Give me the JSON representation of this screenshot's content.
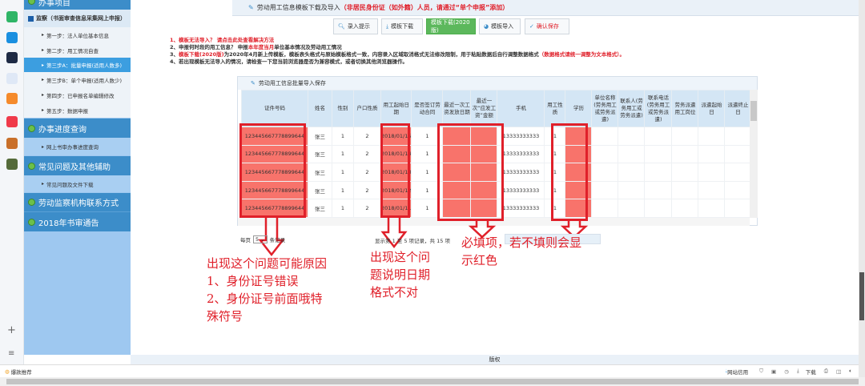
{
  "sidebar": {
    "top_label": "办事项目",
    "section_title": "监察（书面审查信息采集网上申报）",
    "steps": [
      "第一步：法人单位基本信息",
      "第二步：用工情况自查",
      "第三步A：批量申报(适用人数多)",
      "第三步B：单个申报(适用人数少)",
      "第四步：已申报名单编辑修改",
      "第五步：数据申报"
    ],
    "active_step": 2,
    "groups": [
      {
        "label": "办事进度查询",
        "sub": "网上书审办事进度查询"
      },
      {
        "label": "常见问题及其他辅助",
        "sub": "常见问题及文件下载"
      },
      {
        "label": "劳动监察机构联系方式"
      },
      {
        "label": "2018年书审通告"
      }
    ]
  },
  "header": {
    "title": "劳动用工信息模板下载及导入",
    "warning": "（非居民身份证（如外籍）人员，请通过“单个申报”添加）"
  },
  "buttons": {
    "hint": "录入提示",
    "template_download": "模板下载",
    "template_download_2020": "模板下载(2020版)",
    "template_import": "模板导入",
    "confirm_save": "确认保存"
  },
  "notes": [
    {
      "a": "1、模板无法导入？ 请点击此处查看解决方法",
      "b": "",
      "c": "",
      "d": ""
    },
    {
      "a": "2、申报何时段的用工信息？ 申报",
      "b": "本年度当月",
      "c": "单位基本情况及劳动用工情况",
      "d": ""
    },
    {
      "a": "3、",
      "b": "模板下载(2020版)",
      "c": "为2020年4月新上传模板，模板表头格式与原始模板格式一致，内容录入区域取消格式无法修改限制，用于粘贴数据后自行调整数据格式",
      "d": "（数据格式请统一调整为文本格式）。"
    },
    {
      "a": "4、若出现模板无法导入的情况，请检查一下您当前浏览器是否为兼容模式，或者切换其他浏览器操作。",
      "b": "",
      "c": "",
      "d": ""
    }
  ],
  "table": {
    "title": "劳动用工信息批量导入保存",
    "columns": [
      "证件号码",
      "姓名",
      "性别",
      "户口性质",
      "用工起始日期",
      "是否签订劳动合同",
      "最近一次工资发放日期",
      "最近一次“应发工资”金额",
      "手机",
      "用工性质",
      "学历",
      "单位名称(劳务用工或劳务派遣)",
      "联系人(劳务用工或劳务派遣)",
      "联系电话(劳务用工或劳务派遣)",
      "劳务派遣用工岗位",
      "派遣起始日",
      "派遣终止日"
    ],
    "rows": [
      [
        "123445667778899644",
        "张三",
        "1",
        "2",
        "2018/01/15",
        "1",
        "",
        "",
        "13333333333",
        "1",
        "",
        "",
        "",
        "",
        "",
        "",
        ""
      ],
      [
        "123445667778899644",
        "张三",
        "1",
        "2",
        "2018/01/14",
        "1",
        "",
        "",
        "13333333333",
        "1",
        "",
        "",
        "",
        "",
        "",
        "",
        ""
      ],
      [
        "123445667778899644",
        "张三",
        "1",
        "2",
        "2018/01/13",
        "1",
        "",
        "",
        "13333333333",
        "1",
        "",
        "",
        "",
        "",
        "",
        "",
        ""
      ],
      [
        "123445667778899644",
        "张三",
        "1",
        "2",
        "2018/01/12",
        "1",
        "",
        "",
        "13333333333",
        "1",
        "",
        "",
        "",
        "",
        "",
        "",
        ""
      ],
      [
        "123445667778899644",
        "张三",
        "1",
        "2",
        "2018/01/11",
        "1",
        "",
        "",
        "13333333333",
        "1",
        "",
        "",
        "",
        "",
        "",
        "",
        ""
      ]
    ],
    "error_highlight_color": "#f8736b"
  },
  "pagination": {
    "per_page_prefix": "每页",
    "per_page_value": "5",
    "per_page_suffix": "条记录",
    "summary": "显示第 1 至 5 项记录，共 15 项"
  },
  "annotations": {
    "id_issue": [
      "出现这个问题可能原因",
      "1、身份证号错误",
      "2、身份证号前面哦特",
      "殊符号"
    ],
    "date_issue": [
      "出现这个问",
      "题说明日期",
      "格式不对"
    ],
    "required": [
      "必填项，若不填则会显",
      "示红色"
    ]
  },
  "footer": {
    "copyright": "版权"
  },
  "status": {
    "left": "爆款推荐",
    "right": "网站信用",
    "download": "下载"
  }
}
